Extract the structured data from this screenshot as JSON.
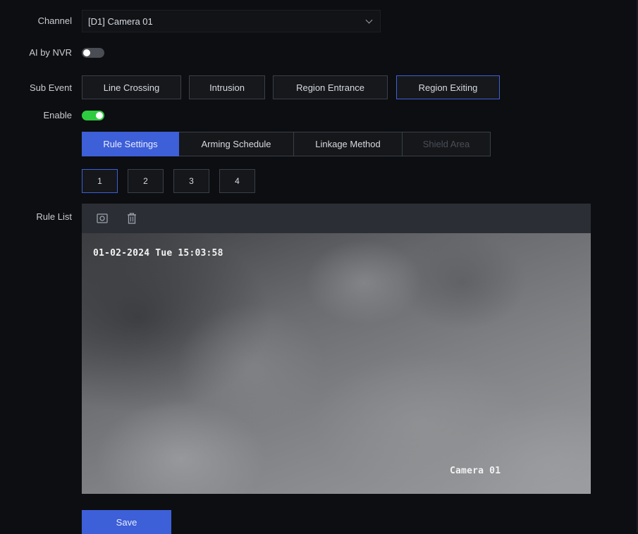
{
  "form": {
    "channel_label": "Channel",
    "channel_value": "[D1] Camera 01",
    "ai_by_nvr_label": "AI by NVR",
    "ai_by_nvr_on": false,
    "sub_event_label": "Sub Event",
    "sub_events": [
      "Line Crossing",
      "Intrusion",
      "Region Entrance",
      "Region Exiting"
    ],
    "sub_event_selected": "Region Exiting",
    "enable_label": "Enable",
    "enable_on": true,
    "tabs": [
      {
        "label": "Rule Settings",
        "state": "active"
      },
      {
        "label": "Arming Schedule",
        "state": "normal"
      },
      {
        "label": "Linkage Method",
        "state": "normal"
      },
      {
        "label": "Shield Area",
        "state": "disabled"
      }
    ],
    "rules": [
      "1",
      "2",
      "3",
      "4"
    ],
    "rule_selected": "1",
    "rule_list_label": "Rule List"
  },
  "toolbar": {
    "icons": [
      "draw-rule-icon",
      "delete-icon"
    ]
  },
  "video": {
    "timestamp": "01-02-2024 Tue 15:03:58",
    "camera_name": "Camera 01"
  },
  "actions": {
    "save_label": "Save"
  },
  "colors": {
    "accent": "#3d5fd8",
    "toggle_on": "#2ecc40",
    "toggle_off": "#4a4d54",
    "background": "#0d0e11"
  }
}
